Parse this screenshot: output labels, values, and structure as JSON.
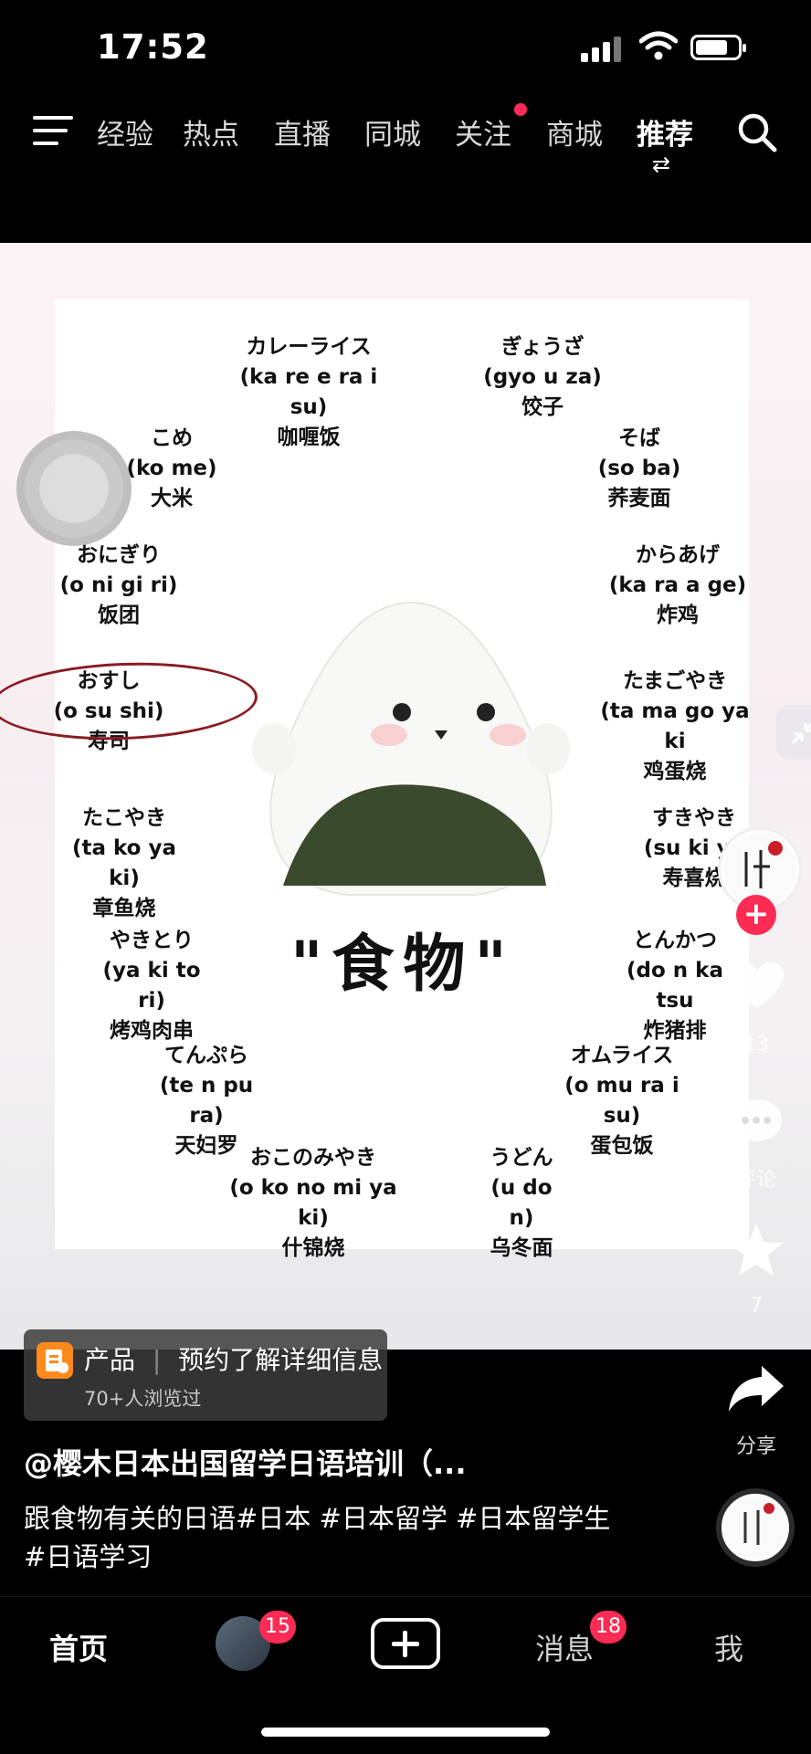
{
  "status_bar": {
    "time": "17:52"
  },
  "top_nav": {
    "tabs": [
      "经验",
      "热点",
      "直播",
      "同城",
      "关注",
      "商城",
      "推荐"
    ],
    "active_tab": "推荐"
  },
  "video": {
    "title": "\"食物\"",
    "items": [
      {
        "jp": "カレーライス",
        "romaji": "(ka re e ra i su)",
        "cn": "咖喱饭"
      },
      {
        "jp": "ぎょうざ",
        "romaji": "(gyo u za)",
        "cn": "饺子"
      },
      {
        "jp": "こめ",
        "romaji": "(ko me)",
        "cn": "大米"
      },
      {
        "jp": "そば",
        "romaji": "(so ba)",
        "cn": "荞麦面"
      },
      {
        "jp": "おにぎり",
        "romaji": "(o ni gi ri)",
        "cn": "饭团"
      },
      {
        "jp": "からあげ",
        "romaji": "(ka ra a ge)",
        "cn": "炸鸡"
      },
      {
        "jp": "おすし",
        "romaji": "(o su shi)",
        "cn": "寿司"
      },
      {
        "jp": "たまごやき",
        "romaji": "(ta ma go ya ki",
        "cn": "鸡蛋烧"
      },
      {
        "jp": "たこやき",
        "romaji": "(ta ko ya ki)",
        "cn": "章鱼烧"
      },
      {
        "jp": "すきやき",
        "romaji": "(su ki ya",
        "cn": "寿喜烧"
      },
      {
        "jp": "やきとり",
        "romaji": "(ya ki to ri)",
        "cn": "烤鸡肉串"
      },
      {
        "jp": "とんかつ",
        "romaji": "(do n ka tsu",
        "cn": "炸猪排"
      },
      {
        "jp": "てんぷら",
        "romaji": "(te n pu ra)",
        "cn": "天妇罗"
      },
      {
        "jp": "オムライス",
        "romaji": "(o mu ra i su)",
        "cn": "蛋包饭"
      },
      {
        "jp": "おこのみやき",
        "romaji": "(o ko no mi ya ki)",
        "cn": "什锦烧"
      },
      {
        "jp": "うどん",
        "romaji": "(u do n)",
        "cn": "乌冬面"
      }
    ]
  },
  "right_rail": {
    "likes": "13",
    "comments_label": "评论",
    "favorites": "7",
    "share_label": "分享"
  },
  "product_banner": {
    "tag": "产品",
    "title": "预约了解详细信息",
    "viewers": "70+人浏览过"
  },
  "caption": {
    "author": "@樱木日本出国留学日语培训（...",
    "text_line1": "跟食物有关的日语#日本 #日本留学 #日本留学生",
    "text_line2": "#日语学习"
  },
  "bottom_nav": {
    "home": "首页",
    "friends_badge": "15",
    "messages": "消息",
    "messages_badge": "18",
    "me": "我"
  },
  "colors": {
    "accent": "#fe2c55",
    "annotation_circle": "#8b1b22",
    "product_icon": "#ff8a1c"
  }
}
